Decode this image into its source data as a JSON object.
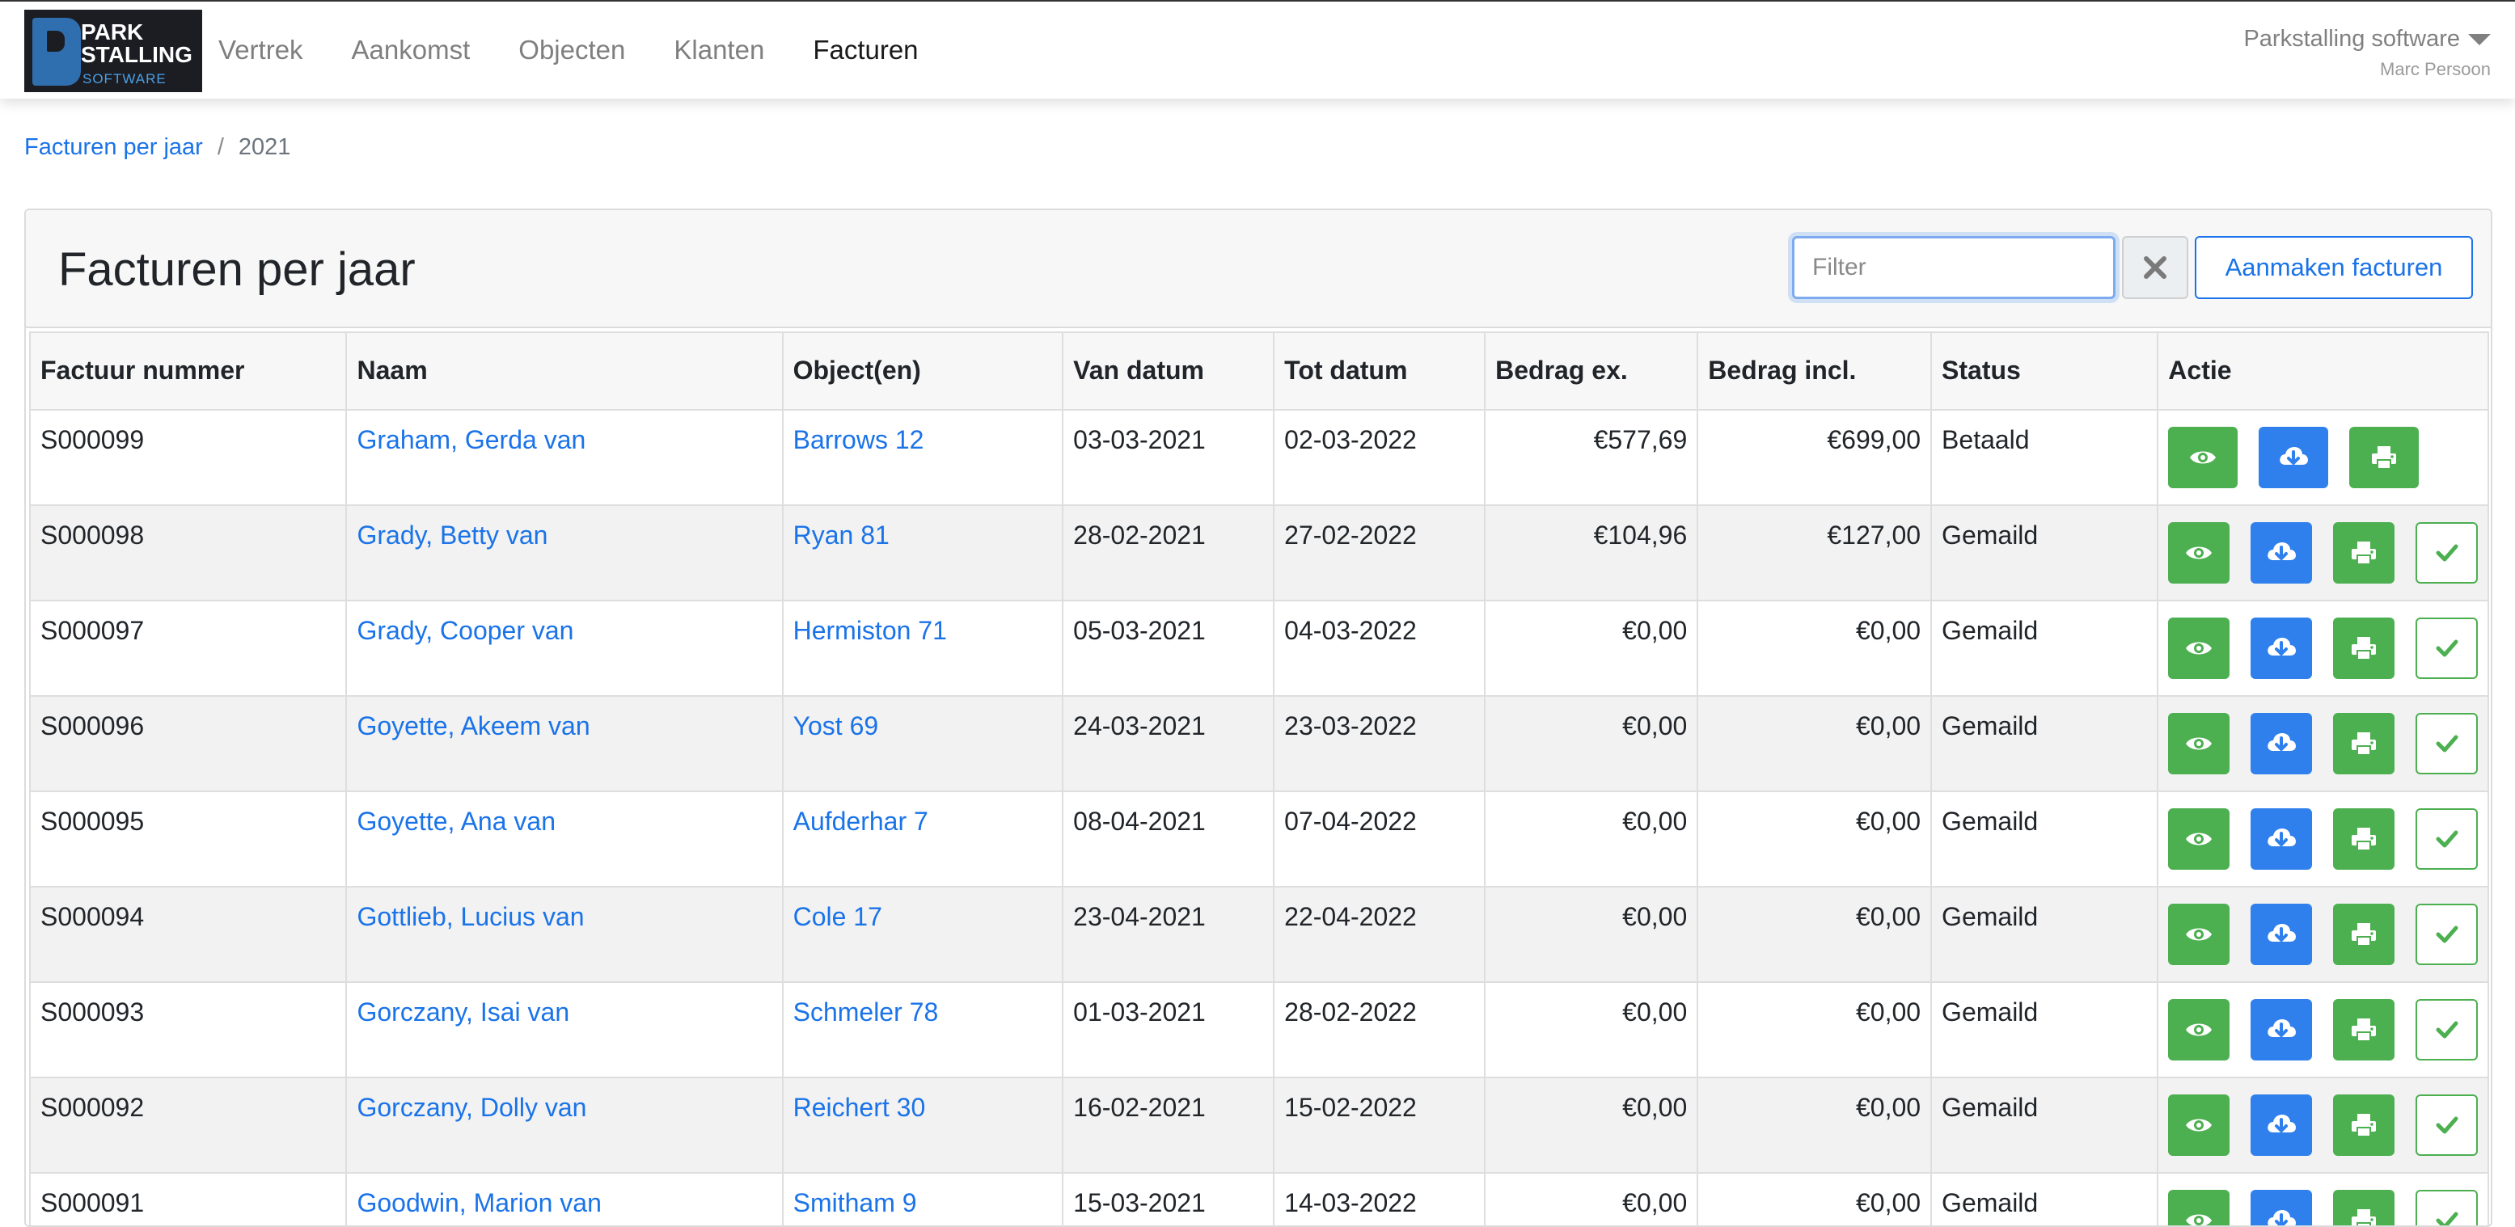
{
  "brand": {
    "line1": "PARK",
    "line2": "STALLING",
    "sub": "SOFTWARE"
  },
  "nav": {
    "items": [
      {
        "label": "Vertrek",
        "active": false
      },
      {
        "label": "Aankomst",
        "active": false
      },
      {
        "label": "Objecten",
        "active": false
      },
      {
        "label": "Klanten",
        "active": false
      },
      {
        "label": "Facturen",
        "active": true
      }
    ]
  },
  "account": {
    "company": "Parkstalling software",
    "user": "Marc Persoon"
  },
  "breadcrumb": {
    "parent": "Facturen per jaar",
    "separator": "/",
    "current": "2021"
  },
  "card": {
    "title": "Facturen per jaar",
    "filter_placeholder": "Filter",
    "filter_value": "",
    "create_label": "Aanmaken facturen"
  },
  "table": {
    "headers": [
      "Factuur nummer",
      "Naam",
      "Object(en)",
      "Van datum",
      "Tot datum",
      "Bedrag ex.",
      "Bedrag incl.",
      "Status",
      "Actie"
    ],
    "rows": [
      {
        "number": "S000099",
        "name": "Graham, Gerda van",
        "object": "Barrows 12",
        "from": "03-03-2021",
        "to": "02-03-2022",
        "ex": "€577,69",
        "incl": "€699,00",
        "status": "Betaald",
        "mark_paid": false
      },
      {
        "number": "S000098",
        "name": "Grady, Betty van",
        "object": "Ryan 81",
        "from": "28-02-2021",
        "to": "27-02-2022",
        "ex": "€104,96",
        "incl": "€127,00",
        "status": "Gemaild",
        "mark_paid": true
      },
      {
        "number": "S000097",
        "name": "Grady, Cooper van",
        "object": "Hermiston 71",
        "from": "05-03-2021",
        "to": "04-03-2022",
        "ex": "€0,00",
        "incl": "€0,00",
        "status": "Gemaild",
        "mark_paid": true
      },
      {
        "number": "S000096",
        "name": "Goyette, Akeem van",
        "object": "Yost 69",
        "from": "24-03-2021",
        "to": "23-03-2022",
        "ex": "€0,00",
        "incl": "€0,00",
        "status": "Gemaild",
        "mark_paid": true
      },
      {
        "number": "S000095",
        "name": "Goyette, Ana van",
        "object": "Aufderhar 7",
        "from": "08-04-2021",
        "to": "07-04-2022",
        "ex": "€0,00",
        "incl": "€0,00",
        "status": "Gemaild",
        "mark_paid": true
      },
      {
        "number": "S000094",
        "name": "Gottlieb, Lucius van",
        "object": "Cole 17",
        "from": "23-04-2021",
        "to": "22-04-2022",
        "ex": "€0,00",
        "incl": "€0,00",
        "status": "Gemaild",
        "mark_paid": true
      },
      {
        "number": "S000093",
        "name": "Gorczany, Isai van",
        "object": "Schmeler 78",
        "from": "01-03-2021",
        "to": "28-02-2022",
        "ex": "€0,00",
        "incl": "€0,00",
        "status": "Gemaild",
        "mark_paid": true
      },
      {
        "number": "S000092",
        "name": "Gorczany, Dolly van",
        "object": "Reichert 30",
        "from": "16-02-2021",
        "to": "15-02-2022",
        "ex": "€0,00",
        "incl": "€0,00",
        "status": "Gemaild",
        "mark_paid": true
      },
      {
        "number": "S000091",
        "name": "Goodwin, Marion van",
        "object": "Smitham 9",
        "from": "15-03-2021",
        "to": "14-03-2022",
        "ex": "€0,00",
        "incl": "€0,00",
        "status": "Gemaild",
        "mark_paid": true
      }
    ]
  },
  "icons": {
    "view": "eye-icon",
    "download": "cloud-download-icon",
    "print": "print-icon",
    "mark_paid": "check-icon",
    "clear": "close-icon",
    "dropdown": "caret-down-icon"
  },
  "colors": {
    "link": "#1a73e8",
    "success": "#4caf50",
    "primary": "#2f80ed",
    "logo_bg": "#1c1d23"
  }
}
